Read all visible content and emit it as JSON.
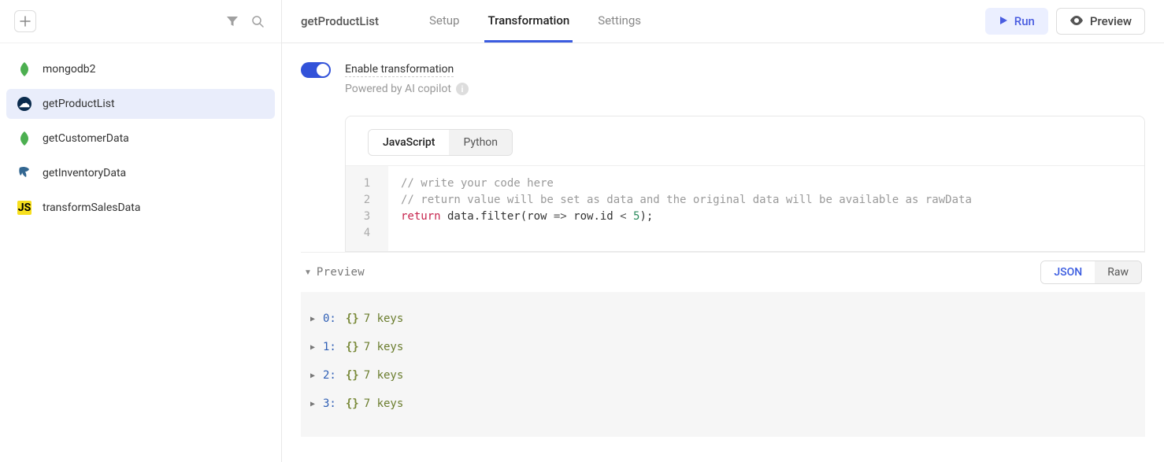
{
  "sidebar": {
    "items": [
      {
        "label": "mongodb2",
        "icon": "mongo"
      },
      {
        "label": "getProductList",
        "icon": "rest",
        "active": true
      },
      {
        "label": "getCustomerData",
        "icon": "mongo"
      },
      {
        "label": "getInventoryData",
        "icon": "pg"
      },
      {
        "label": "transformSalesData",
        "icon": "js"
      }
    ]
  },
  "header": {
    "title": "getProductList",
    "tabs": [
      {
        "label": "Setup"
      },
      {
        "label": "Transformation",
        "active": true
      },
      {
        "label": "Settings"
      }
    ],
    "run": "Run",
    "preview": "Preview"
  },
  "transformation": {
    "toggle_label": "Enable transformation",
    "subtitle": "Powered by AI copilot",
    "lang_tabs": [
      {
        "label": "JavaScript",
        "active": true
      },
      {
        "label": "Python"
      }
    ],
    "code": {
      "line1": "// write your code here",
      "line2": "// return value will be set as data and the original data will be available as rawData",
      "line3_kw": "return",
      "line3_part1": " data.filter(row ",
      "line3_arrow": "=>",
      "line3_part2": " row.id ",
      "line3_op": "<",
      "line3_num": " 5",
      "line3_end": ");"
    },
    "gutter": [
      "1",
      "2",
      "3",
      "4"
    ]
  },
  "preview": {
    "title": "Preview",
    "view_tabs": [
      {
        "label": "JSON",
        "active": true
      },
      {
        "label": "Raw"
      }
    ],
    "rows": [
      {
        "index": "0:",
        "keys": "7 keys"
      },
      {
        "index": "1:",
        "keys": "7 keys"
      },
      {
        "index": "2:",
        "keys": "7 keys"
      },
      {
        "index": "3:",
        "keys": "7 keys"
      }
    ]
  }
}
